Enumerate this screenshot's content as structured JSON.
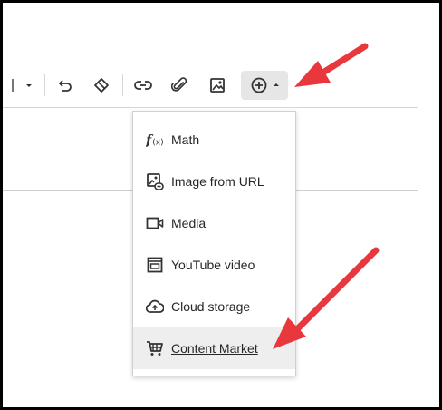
{
  "toolbar": {
    "buttons": [
      {
        "name": "format-dropdown",
        "icon": "chevron-down-icon"
      },
      {
        "name": "undo",
        "icon": "undo-icon"
      },
      {
        "name": "clear-formatting",
        "icon": "eraser-icon"
      },
      {
        "name": "link",
        "icon": "link-icon"
      },
      {
        "name": "attachment",
        "icon": "paperclip-icon"
      },
      {
        "name": "image",
        "icon": "image-icon"
      },
      {
        "name": "insert",
        "icon": "plus-circle-icon",
        "state": "expanded"
      }
    ]
  },
  "insert_menu": {
    "items": [
      {
        "label": "Math",
        "icon": "math-function-icon"
      },
      {
        "label": "Image from URL",
        "icon": "image-link-icon"
      },
      {
        "label": "Media",
        "icon": "video-camera-icon"
      },
      {
        "label": "YouTube video",
        "icon": "youtube-frame-icon"
      },
      {
        "label": "Cloud storage",
        "icon": "cloud-upload-icon"
      },
      {
        "label": "Content Market",
        "icon": "shopping-cart-icon",
        "hovered": true
      }
    ]
  },
  "annotations": {
    "arrow_color": "#e8383d",
    "arrows": [
      "insert-button-arrow",
      "content-market-arrow"
    ]
  },
  "colors": {
    "icon": "#333333",
    "border": "#d0d0d0",
    "active_bg": "#e6e6e6",
    "hover_bg": "#eeeeee"
  }
}
